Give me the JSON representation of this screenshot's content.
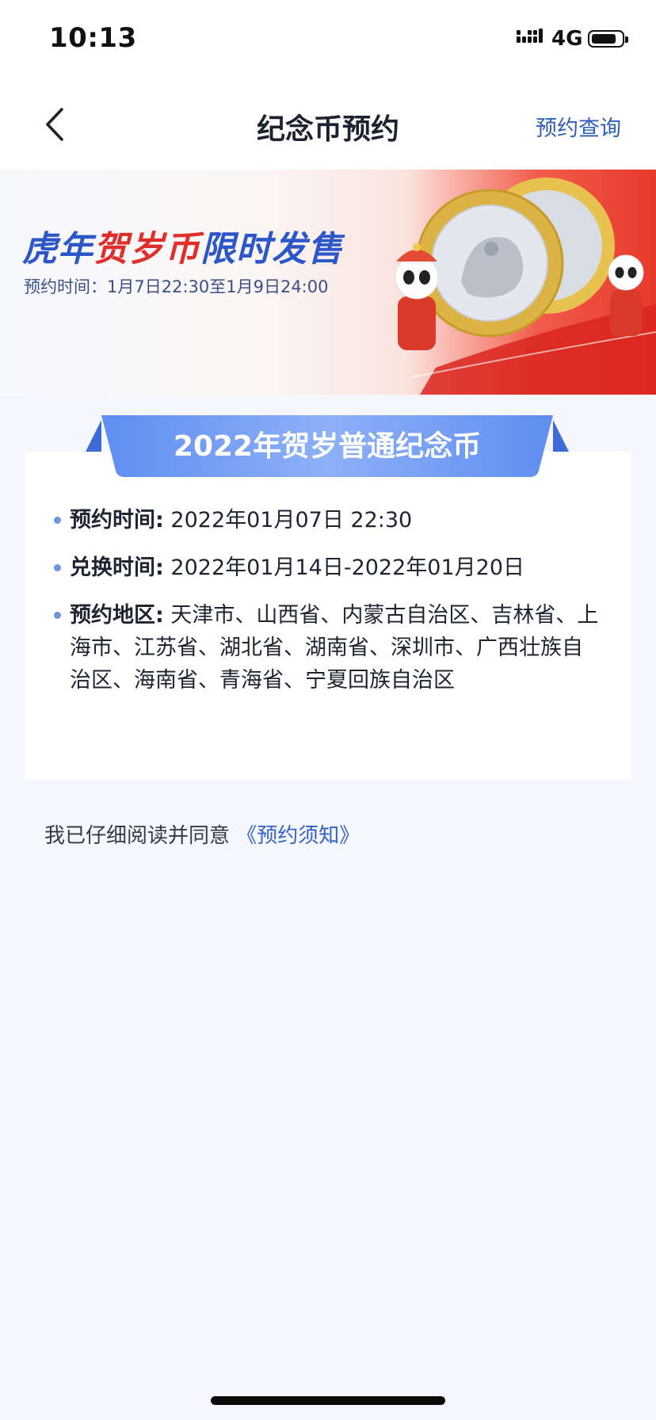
{
  "status": {
    "time": "10:13",
    "network": "4G"
  },
  "nav": {
    "title": "纪念币预约",
    "action": "预约查询"
  },
  "banner": {
    "title_part1": "虎年",
    "title_part2": "贺岁币",
    "title_part3": "限时发售",
    "subtitle": "预约时间：1月7日22:30至1月9日24:00"
  },
  "card": {
    "ribbon_title": "2022年贺岁普通纪念币",
    "rows": [
      {
        "label": "预约时间:",
        "value": "2022年01月07日 22:30"
      },
      {
        "label": "兑换时间:",
        "value": "2022年01月14日-2022年01月20日"
      },
      {
        "label": "预约地区:",
        "value": "天津市、山西省、内蒙古自治区、吉林省、上海市、江苏省、湖北省、湖南省、深圳市、广西壮族自治区、海南省、青海省、宁夏回族自治区"
      }
    ]
  },
  "agreement": {
    "text": "我已仔细阅读并同意",
    "link": "《预约须知》"
  },
  "colors": {
    "accent": "#2f5eb8",
    "ribbon": "#6f9bf2",
    "banner_red": "#e6392c"
  },
  "icons": [
    "signal-icon",
    "battery-icon",
    "back-chevron-icon",
    "coin-illustration",
    "panda-mascot-icon"
  ]
}
